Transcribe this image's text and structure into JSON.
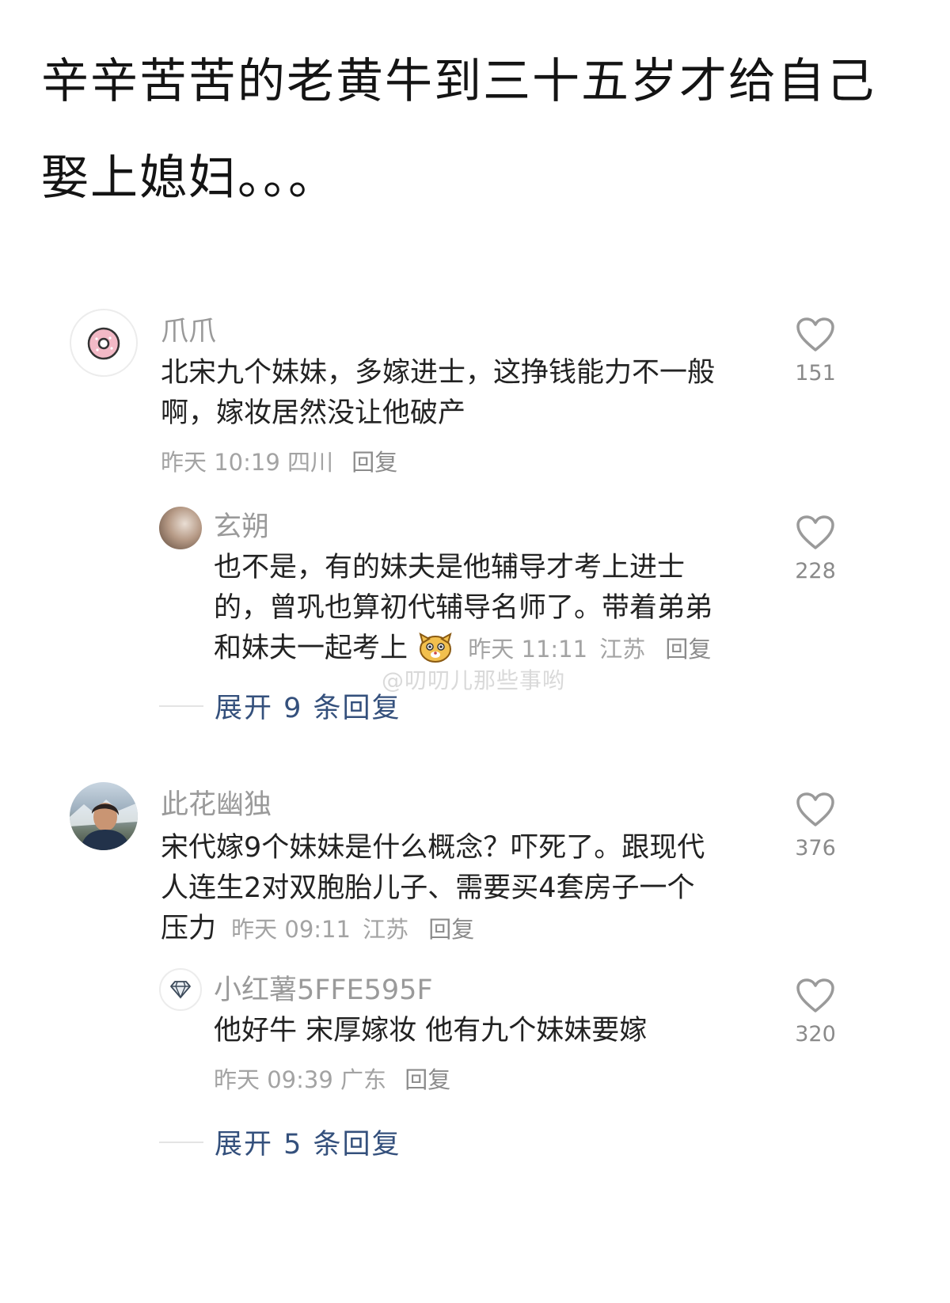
{
  "post": {
    "title": "辛辛苦苦的老黄牛到三十五岁才给自己娶上媳妇。。。"
  },
  "watermark": "@叨叨儿那些事哟",
  "comments": [
    {
      "author": "爪爪",
      "text": "北宋九个妹妹，多嫁进士，这挣钱能力不一般啊，嫁妆居然没让他破产",
      "time": "昨天 10:19",
      "location": "四川",
      "reply_label": "回复",
      "likes": "151",
      "avatar_icon": "donut-icon",
      "replies": [
        {
          "author": "玄朔",
          "text_line1": "也不是，有的妹夫是他辅导才考上进士",
          "text_line2": "的，曾巩也算初代辅导名师了。带着弟弟",
          "text_line3": "和妹夫一起考上",
          "emoji": "dog-face-emoji",
          "time": "昨天 11:11",
          "location": "江苏",
          "reply_label": "回复",
          "likes": "228"
        }
      ],
      "expand_label": "展开 9 条回复"
    },
    {
      "author": "此花幽独",
      "text_line1": "宋代嫁9个妹妹是什么概念？吓死了。跟现代",
      "text_line2": "人连生2对双胞胎儿子、需要买4套房子一个",
      "text_line3": "压力",
      "time": "昨天 09:11",
      "location": "江苏",
      "reply_label": "回复",
      "likes": "376",
      "avatar_icon": "person-photo-avatar",
      "replies": [
        {
          "author": "小红薯5FFE595F",
          "text": "他好牛 宋厚嫁妆 他有九个妹妹要嫁",
          "time": "昨天 09:39",
          "location": "广东",
          "reply_label": "回复",
          "likes": "320",
          "avatar_icon": "diamond-icon"
        }
      ],
      "expand_label": "展开 5 条回复"
    }
  ],
  "colors": {
    "expand_link": "#34507c",
    "meta_gray": "#a3a3a3",
    "heart_stroke": "#9a9a9a"
  }
}
